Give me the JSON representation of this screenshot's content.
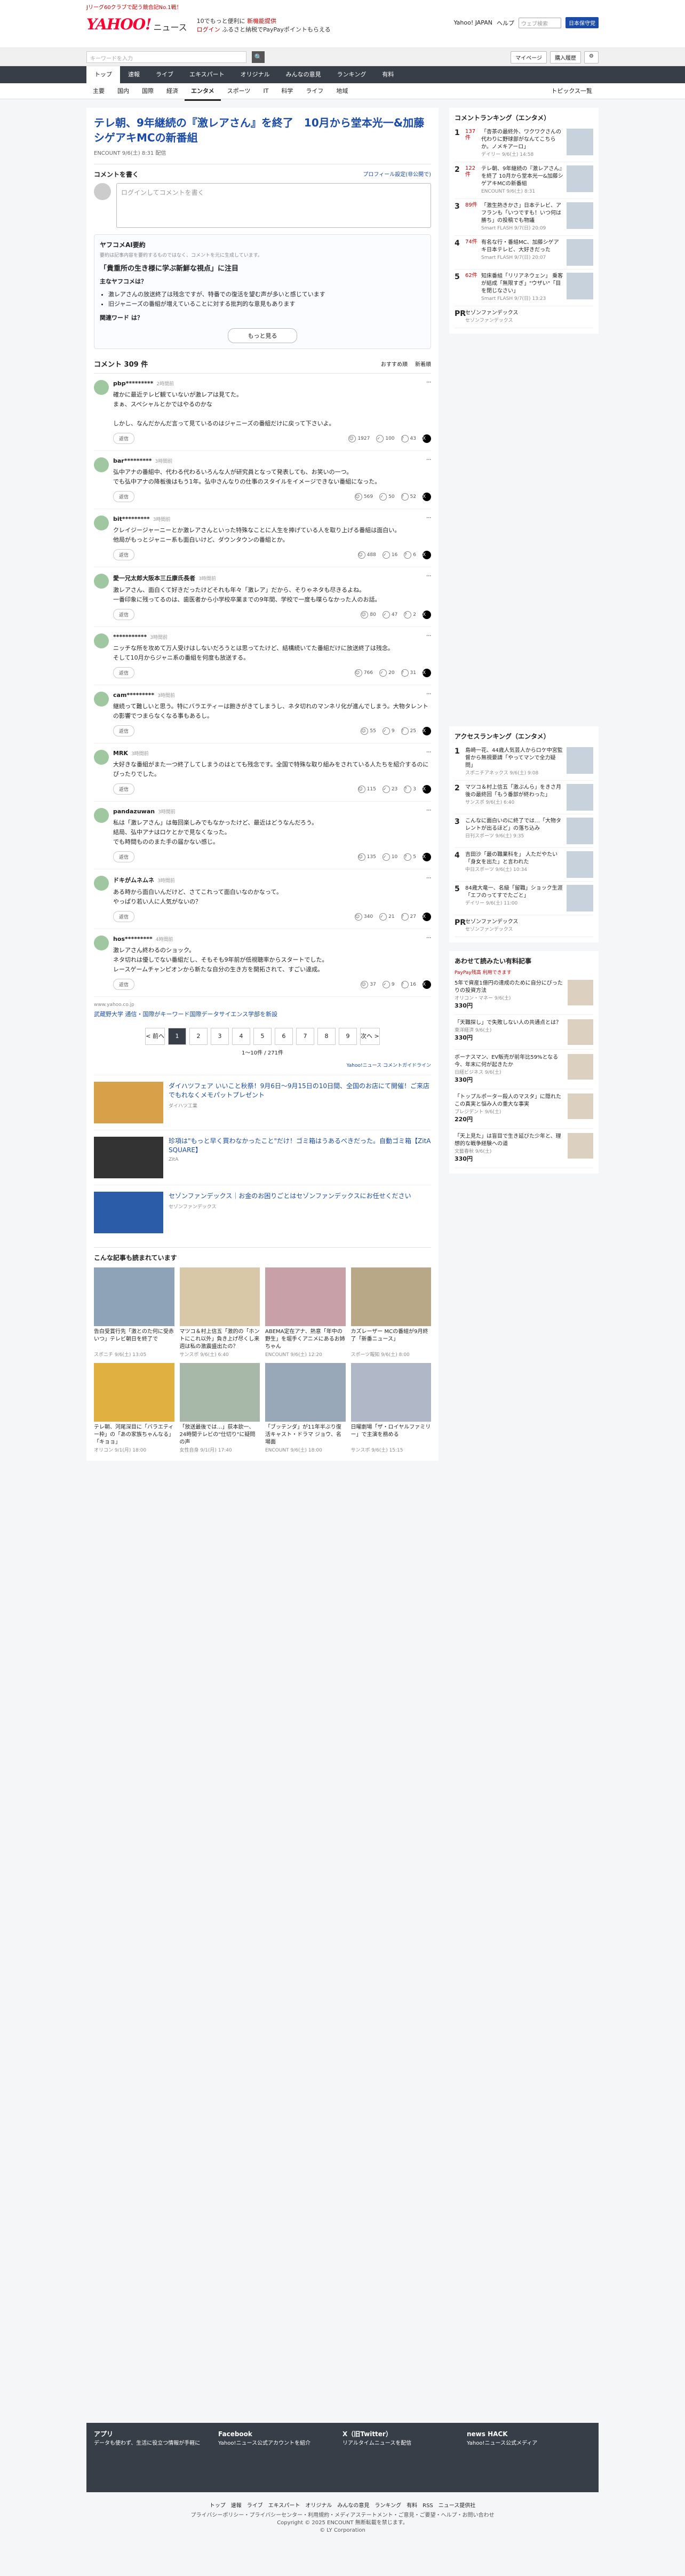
{
  "topstrip": {
    "text": "Jリーグ60クラブで配う競合記No.1戦！"
  },
  "header": {
    "logo": "YAHOO!",
    "logo_sub": "ニュース",
    "promo1": "10でもっと便利に",
    "promo1b": "新機能提供",
    "promo2": "ログイン",
    "promo2b": "ふるさと納税でPayPayポイントもらえる",
    "link1": "Yahoo! JAPAN",
    "link2": "ヘルプ",
    "search_ph": "ウェブ検索",
    "login": "ログイン",
    "register": "日本保守党"
  },
  "searchrow": {
    "placeholder": "キーワードを入力",
    "mypage": "マイページ",
    "premium": "購入履歴"
  },
  "nav": [
    "トップ",
    "速報",
    "ライブ",
    "エキスパート",
    "オリジナル",
    "みんなの意見",
    "ランキング",
    "有料"
  ],
  "subnav": [
    "主要",
    "国内",
    "国際",
    "経済",
    "エンタメ",
    "スポーツ",
    "IT",
    "科学",
    "ライフ",
    "地域"
  ],
  "subnav_right": "トピックス一覧",
  "article": {
    "title": "テレ朝、9年継続の『激レアさん』を終了　10月から堂本光一&加藤シゲアキMCの新番組",
    "source": "ENCOUNT",
    "date": "9/6(土) 8:31 配信"
  },
  "comment_write": {
    "label": "コメントを書く",
    "profile": "プロフィール設定(非公開で)",
    "placeholder": "ログインしてコメントを書く"
  },
  "ai": {
    "title": "ヤフコメAI要約",
    "disclaimer": "要約は記事内容を要約するものではなく、コメントを元に生成しています。",
    "headline": "「貴重所の生き様に学ぶ新鮮な視点」に注目",
    "sub": "主なヤフコメは？",
    "points": [
      "激レアさんの放送終了は残念ですが、特番での復活を望む声が多いと感じています",
      "旧ジャニーズの番組が増えていることに対する批判的な意見もあります"
    ],
    "q": "関連ワード は？",
    "more": "もっと見る"
  },
  "comments_header": {
    "count": "コメント 309 件",
    "sort1": "おすすめ順",
    "sort2": "新着順"
  },
  "comments": [
    {
      "user": "pbp*********",
      "time": "2時間前",
      "text": "確かに最近テレビ観ていないが激レアは見てた。\nまぁ、スペシャルとかではやるのかな\n\nしかし、なんだかんだ言って見ているのはジャニーズの番組だけに戻って下さいよ。",
      "like": "1927",
      "ok": "100",
      "bad": "43"
    },
    {
      "user": "bar*********",
      "time": "3時間前",
      "text": "弘中アナの番組中、代わる代わるいろんな人が研究員となって発表しても、お笑いの一つ。\nでも弘中アナの降板後はもう1年。弘中さんなりの仕事のスタイルをイメージできない番組になった。",
      "like": "569",
      "ok": "50",
      "bad": "52"
    },
    {
      "user": "bit*********",
      "time": "3時間前",
      "text": "クレイジージャーニーとか激レアさんといった特殊なことに人生を捧げている人を取り上げる番組は面白い。\n他局がもっとジャニー系も面白いけど、ダウンタウンの番組とか。",
      "like": "488",
      "ok": "16",
      "bad": "6"
    },
    {
      "user": "愛一兄太郎大阪本三丘康氏長者",
      "time": "3時間前",
      "text": "激レアさん、面白くて好きだったけどそれも年々「激レア」だから、そりゃネタも尽きるよね。\n一番印象に残ってるのは、歯医者から小学校卒業までの9年間、学校で一度も喋らなかった人のお話。",
      "like": "80",
      "ok": "47",
      "bad": "2"
    },
    {
      "user": "***********",
      "time": "3時間前",
      "text": "ニッチな所を攻めて万人受けはしないだろうとは思ってたけど、結構続いてた番組だけに放送終了は残念。\nそして10月からジャニ系の番組を何度も放送する。",
      "like": "766",
      "ok": "20",
      "bad": "31"
    },
    {
      "user": "cam*********",
      "time": "3時間前",
      "text": "継続って難しいと思う。特にバラエティーは飽きがきてしまうし、ネタ切れのマンネリ化が進んでしまう。大物タレントの影響でつまらなくなる事もあるし。",
      "like": "55",
      "ok": "9",
      "bad": "25"
    },
    {
      "user": "MRK",
      "time": "3時間前",
      "text": "大好きな番組がまた一つ終了してしまうのはとても残念です。全国で特殊な取り組みをされている人たちを紹介するのにぴったりでした。",
      "like": "115",
      "ok": "23",
      "bad": "3"
    },
    {
      "user": "pandazuwan",
      "time": "3時間前",
      "text": "私は「激レアさん」は毎回楽しみでもなかったけど、最近はどうなんだろう。\n結局、弘中アナはロケとかで見なくなった。\nでも時間もののまた手の届かない感じ。",
      "like": "135",
      "ok": "10",
      "bad": "5"
    },
    {
      "user": "ドキがムネムネ",
      "time": "3時間前",
      "text": "ある時から面白いんだけど、さてこれって面白いなのかなって。\nやっぱり若い人に人気がないの？",
      "like": "340",
      "ok": "21",
      "bad": "27"
    },
    {
      "user": "hos*********",
      "time": "4時間前",
      "text": "激レアさん終わるのショック。\nネタ切れは優しでない番組だし、そもそも9年前が低視聴率からスタートでした。\nレースゲームチャンピオンから新たな自分の生き方を開拓されて、すごい達成。",
      "like": "37",
      "ok": "9",
      "bad": "16"
    }
  ],
  "ad": {
    "source": "www.yahoo.co.jp",
    "title": "武蔵野大学 通信・国際がキーワード国際データサイエンス学部を新設"
  },
  "pager": {
    "prev": "< 前へ",
    "pages": [
      "1",
      "2",
      "3",
      "4",
      "5",
      "6",
      "7",
      "8",
      "9"
    ],
    "next": "次へ >",
    "count": "1〜10件 / 271件"
  },
  "adlinks": {
    "label": "Yahoo!ニュース コメントガイドライン"
  },
  "ads": [
    {
      "title": "ダイハツフェア いいこと秋祭！9月6日〜9月15日の10日間、全国のお店にて開催！ご来店でもれなくメモパットプレゼント",
      "src": "ダイハツ工業"
    },
    {
      "title": "珍項は\"もっと早く買わなかったこと\"だけ！ゴミ箱はうあるべきだった。自動ゴミ箱【ZitA SQUARE】",
      "src": "ZitA"
    },
    {
      "title": "セゾンファンデックス｜お金のお困りごとはセゾンファンデックスにお任せください",
      "src": "セゾンファンデックス"
    }
  ],
  "recommend": {
    "header": "こんな記事も読まれています",
    "items": [
      {
        "title": "告白受賞行先「激とのた何に受赤いつ」テレビ朝日を終了で",
        "src": "スポニチ",
        "date": "9/6(土) 13:05"
      },
      {
        "title": "マツコ＆村上信五「激的の「ホントにこれ以外」負き上げ尽くし来週は私の激震盛出たの？",
        "src": "サンスポ",
        "date": "9/6(土) 6:40"
      },
      {
        "title": "ABEMA定在アナ、熱意「年中の野生」を堀手くアニメにあるお姉ちゃん",
        "src": "ENCOUNT",
        "date": "9/6(土) 12:20"
      },
      {
        "title": "カズレーザー MCの番組が9月終了「新番ニュース」",
        "src": "スポーツ報知",
        "date": "9/6(土) 8:00"
      },
      {
        "title": "テレ朝、河尾深目に「バラエティー枠」の「あの家族ちゃんなる」「キョョ」",
        "src": "オリコン",
        "date": "9/1(月) 18:00"
      },
      {
        "title": "「放送最後では…」荻本欽一、24時間テレビの\"仕切り\"に疑問の声",
        "src": "女性自身",
        "date": "9/1(月) 17:40"
      },
      {
        "title": "「ブッテンダ」が11年半ぶり復活キャスト・ドラマ ジョウ、名場面",
        "src": "ENCOUNT",
        "date": "9/6(土) 18:00"
      },
      {
        "title": "日曜劇場「ザ・ロイヤルファミリー」で主演を務める",
        "src": "サンスポ",
        "date": "9/6(土) 15:15"
      }
    ]
  },
  "ranking": {
    "header": "コメントランキング（エンタメ）",
    "items": [
      {
        "n": "1",
        "c": "137件",
        "t": "「杏茶の最終外、ワクワクさんの代わりに野球部がなんてこちらか。ノメキアーロ」",
        "s": "デイリー 9/6(土) 14:58"
      },
      {
        "n": "2",
        "c": "122件",
        "t": "テレ朝、9年継続の『激レアさん』を終了 10月から堂本光一&加藤シゲアキMCの新番組",
        "s": "ENCOUNT 9/6(土) 8:31"
      },
      {
        "n": "3",
        "c": "89件",
        "t": "「激生熱きかさ」日本テレビ、アフランも「いつですも！いつ何は勝ち」の投稿でも物議",
        "s": "Smart FLASH 9/7(日) 20:09"
      },
      {
        "n": "4",
        "c": "74件",
        "t": "有名な行・番組MC、加藤シゲアキ日本テレビ、大好きだった",
        "s": "Smart FLASH 9/7(日) 20:07"
      },
      {
        "n": "5",
        "c": "62件",
        "t": "知床番組「リリアネウェン」 乗客が結成「無限すぎ」\"ウザい\"「目を閉じなさい」",
        "s": "Smart FLASH 9/7(日) 13:23"
      }
    ],
    "pr_t": "セゾンファンデックス",
    "pr_s": "セゾンファンデックス"
  },
  "access": {
    "header": "アクセスランキング（エンタメ）",
    "items": [
      {
        "n": "1",
        "t": "島崎一花、44歳人気芸人からロケ中宮監督から無視要請「やってマンで全力疑問」",
        "s": "スポニチアネックス 9/6(土) 9:08"
      },
      {
        "n": "2",
        "t": "マツコ＆村上信五「激ぶんら」をきさ月後の最終回「もう番部が終わった」",
        "s": "サンスポ 9/6(土) 6:40"
      },
      {
        "n": "3",
        "t": "こんなに面白いのに終了では…「大物タレントが出るほど」の落ち込み",
        "s": "日刊スポーツ 9/6(土) 9:35"
      },
      {
        "n": "4",
        "t": "吉田沙「最の職業科を」 人ただやたい「身女を出た」と言われた",
        "s": "中日スポーツ 9/6(土) 10:34"
      },
      {
        "n": "5",
        "t": "84歳大竜一、名級「留職」ショック生涯「エフのってすでたごと」",
        "s": "デイリー 9/6(土) 11:00"
      }
    ],
    "pr_t": "セゾンファンデックス",
    "pr_s": "セゾンファンデックス"
  },
  "goods": {
    "header": "あわせて読みたい有料記事",
    "sub": "PayPay残高 利用できます",
    "items": [
      {
        "t": "5年で資産1億円の達成のために自分にぴったりの投資方法",
        "s": "オリコン・マネー 9/6(土)",
        "p": "330円"
      },
      {
        "t": "「天職探し」で失敗しない人の共通点とは？",
        "s": "東洋経済 9/6(土)",
        "p": "330円"
      },
      {
        "t": "ボーナスマン、EV販売が前年比59%となる今、年末に何が起きたか",
        "s": "日経ビジネス 9/6(土)",
        "p": "330円"
      },
      {
        "t": "「トップルポーター殺人のマスタ」に隠れたこの真実と悩み人の重大な事実",
        "s": "プレジデント 9/6(土)",
        "p": "220円"
      },
      {
        "t": "「天上見た」は盲目で生き延びた少年と、理想的な戦争経験への道",
        "s": "文藝春秋 9/6(土)",
        "p": "330円"
      }
    ]
  },
  "footer": {
    "cells": [
      {
        "t": "アプリ",
        "d": "データも使わず、生活に役立つ情報が手軽に"
      },
      {
        "t": "Facebook",
        "d": "Yahoo!ニュース公式アカウントを紹介"
      },
      {
        "t": "X（旧Twitter）",
        "d": "リアルタイムニュースを配信"
      },
      {
        "t": "news HACK",
        "d": "Yahoo!ニュース公式メディア"
      }
    ],
    "links": "トップ　速報　ライブ　エキスパート　オリジナル　みんなの意見　ランキング　有料　RSS　ニュース提供社",
    "policy": "プライバシーポリシー・プライバシーセンター・利用規約・メディアステートメント・ご意見・ご要望・ヘルプ・お問い合わせ",
    "copy1": "Copyright © 2025 ENCOUNT 無断転載を禁じます。",
    "copy2": "© LY Corporation"
  }
}
